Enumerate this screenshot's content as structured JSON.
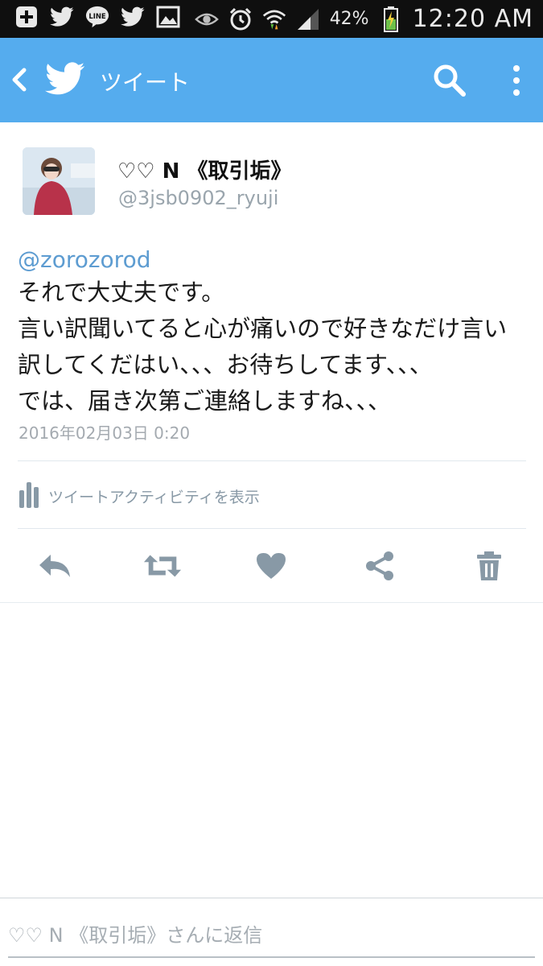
{
  "status_bar": {
    "left_icons": [
      "add-icon",
      "twitter-icon",
      "line-icon",
      "twitter-icon",
      "gallery-icon"
    ],
    "right_icons": [
      "eye-icon",
      "alarm-icon",
      "wifi-icon",
      "signal-icon",
      "battery-icon"
    ],
    "battery": "42%",
    "time": "12:20 AM"
  },
  "appbar": {
    "title": "ツイート",
    "color": "#55acee"
  },
  "tweet": {
    "display_name": "♡♡ N 《取引垢》",
    "handle": "@3jsb0902_ryuji",
    "mention": "@zorozorod",
    "lines": [
      "それで大丈夫です。",
      "言い訳聞いてると心が痛いので好きなだけ言い",
      "訳してくだはい、、、お待ちしてます、、、",
      "では、届き次第ご連絡しますね、、、"
    ],
    "timestamp": "2016年02月03日 0:20",
    "activity_label": "ツイートアクティビティを表示"
  },
  "actions": [
    "reply-icon",
    "retweet-icon",
    "like-icon",
    "share-icon",
    "delete-icon"
  ],
  "reply": {
    "placeholder": "♡♡ N 《取引垢》さんに返信"
  }
}
